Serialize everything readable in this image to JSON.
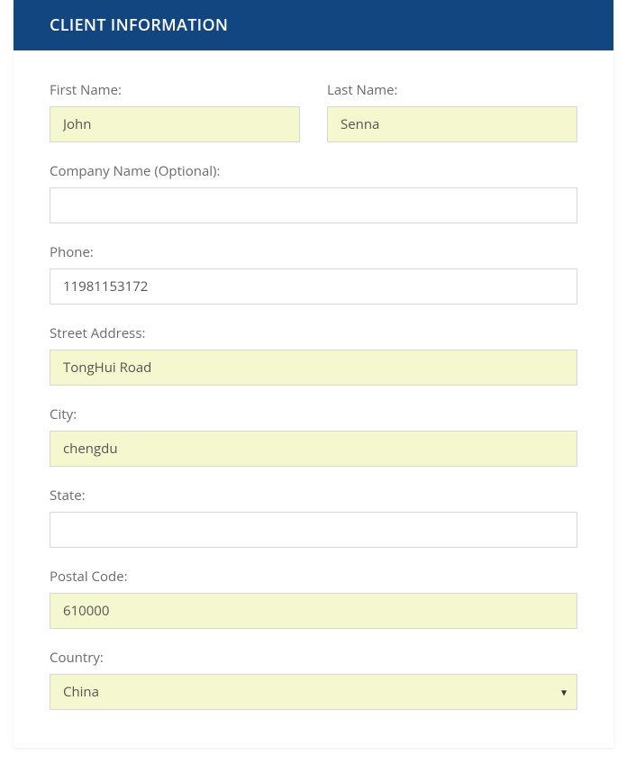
{
  "header": {
    "title": "CLIENT INFORMATION"
  },
  "form": {
    "firstName": {
      "label": "First Name:",
      "value": "John"
    },
    "lastName": {
      "label": "Last Name:",
      "value": "Senna"
    },
    "companyName": {
      "label": "Company Name (Optional):",
      "value": ""
    },
    "phone": {
      "label": "Phone:",
      "value": "11981153172"
    },
    "streetAddress": {
      "label": "Street Address:",
      "value": "TongHui Road"
    },
    "city": {
      "label": "City:",
      "value": "chengdu"
    },
    "state": {
      "label": "State:",
      "value": ""
    },
    "postalCode": {
      "label": "Postal Code:",
      "value": "610000"
    },
    "country": {
      "label": "Country:",
      "value": "China"
    }
  }
}
